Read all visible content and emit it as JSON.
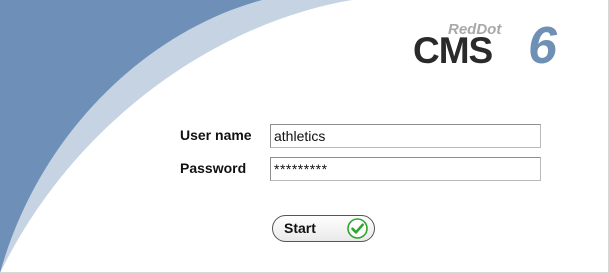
{
  "logo": {
    "brand": "RedDot",
    "product": "CMS",
    "version": "6"
  },
  "form": {
    "username_label": "User name",
    "username_value": "athletics",
    "password_label": "Password",
    "password_value": "*********"
  },
  "start_button": {
    "label": "Start",
    "icon": "check-icon"
  },
  "colors": {
    "swoosh_dark": "#6d8fb8",
    "swoosh_light": "#c6d3e3",
    "accent": "#6f90b5",
    "check_green": "#2fa52f"
  }
}
